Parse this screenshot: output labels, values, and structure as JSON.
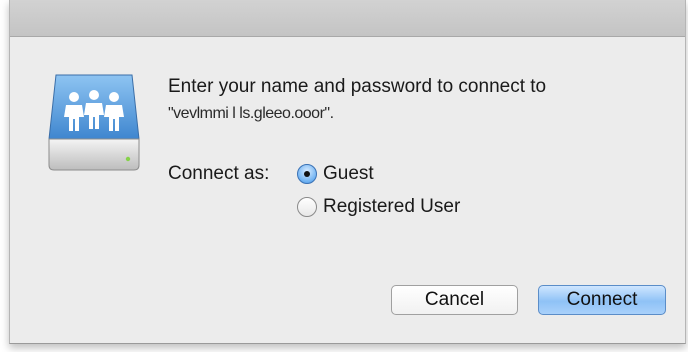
{
  "dialog": {
    "message": "Enter your name and password to connect to",
    "server_name": "\"vevlmmi l ls.gleeo.ooor\".",
    "connect_as_label": "Connect as:",
    "options": [
      {
        "label": "Guest",
        "selected": true
      },
      {
        "label": "Registered User",
        "selected": false
      }
    ],
    "buttons": {
      "cancel": "Cancel",
      "connect": "Connect"
    },
    "icon": "shared-server-icon",
    "colors": {
      "accent": "#6fb2f2",
      "background": "#ececec",
      "icon_blue": "#5fa0e0"
    }
  }
}
